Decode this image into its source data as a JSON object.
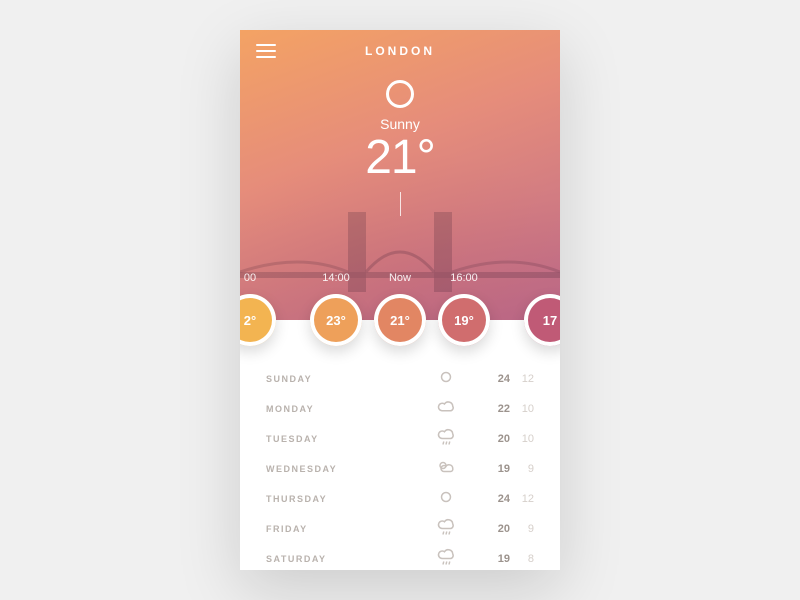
{
  "city": "LONDON",
  "current": {
    "condition": "Sunny",
    "temp": "21°"
  },
  "hourly": [
    {
      "label": "00",
      "temp": "2°",
      "colorClass": "c1"
    },
    {
      "label": "14:00",
      "temp": "23°",
      "colorClass": "c2"
    },
    {
      "label": "Now",
      "temp": "21°",
      "colorClass": "c3"
    },
    {
      "label": "16:00",
      "temp": "19°",
      "colorClass": "c4"
    },
    {
      "label": "",
      "temp": "17",
      "colorClass": "c5"
    }
  ],
  "forecast": [
    {
      "day": "SUNDAY",
      "icon": "sunny",
      "hi": "24",
      "lo": "12"
    },
    {
      "day": "MONDAY",
      "icon": "cloudy",
      "hi": "22",
      "lo": "10"
    },
    {
      "day": "TUESDAY",
      "icon": "rain",
      "hi": "20",
      "lo": "10"
    },
    {
      "day": "WEDNESDAY",
      "icon": "partly",
      "hi": "19",
      "lo": "9"
    },
    {
      "day": "THURSDAY",
      "icon": "sunny",
      "hi": "24",
      "lo": "12"
    },
    {
      "day": "FRIDAY",
      "icon": "rain",
      "hi": "20",
      "lo": "9"
    },
    {
      "day": "SATURDAY",
      "icon": "rain",
      "hi": "19",
      "lo": "8"
    }
  ],
  "pager": {
    "count": 5,
    "active": 4
  }
}
